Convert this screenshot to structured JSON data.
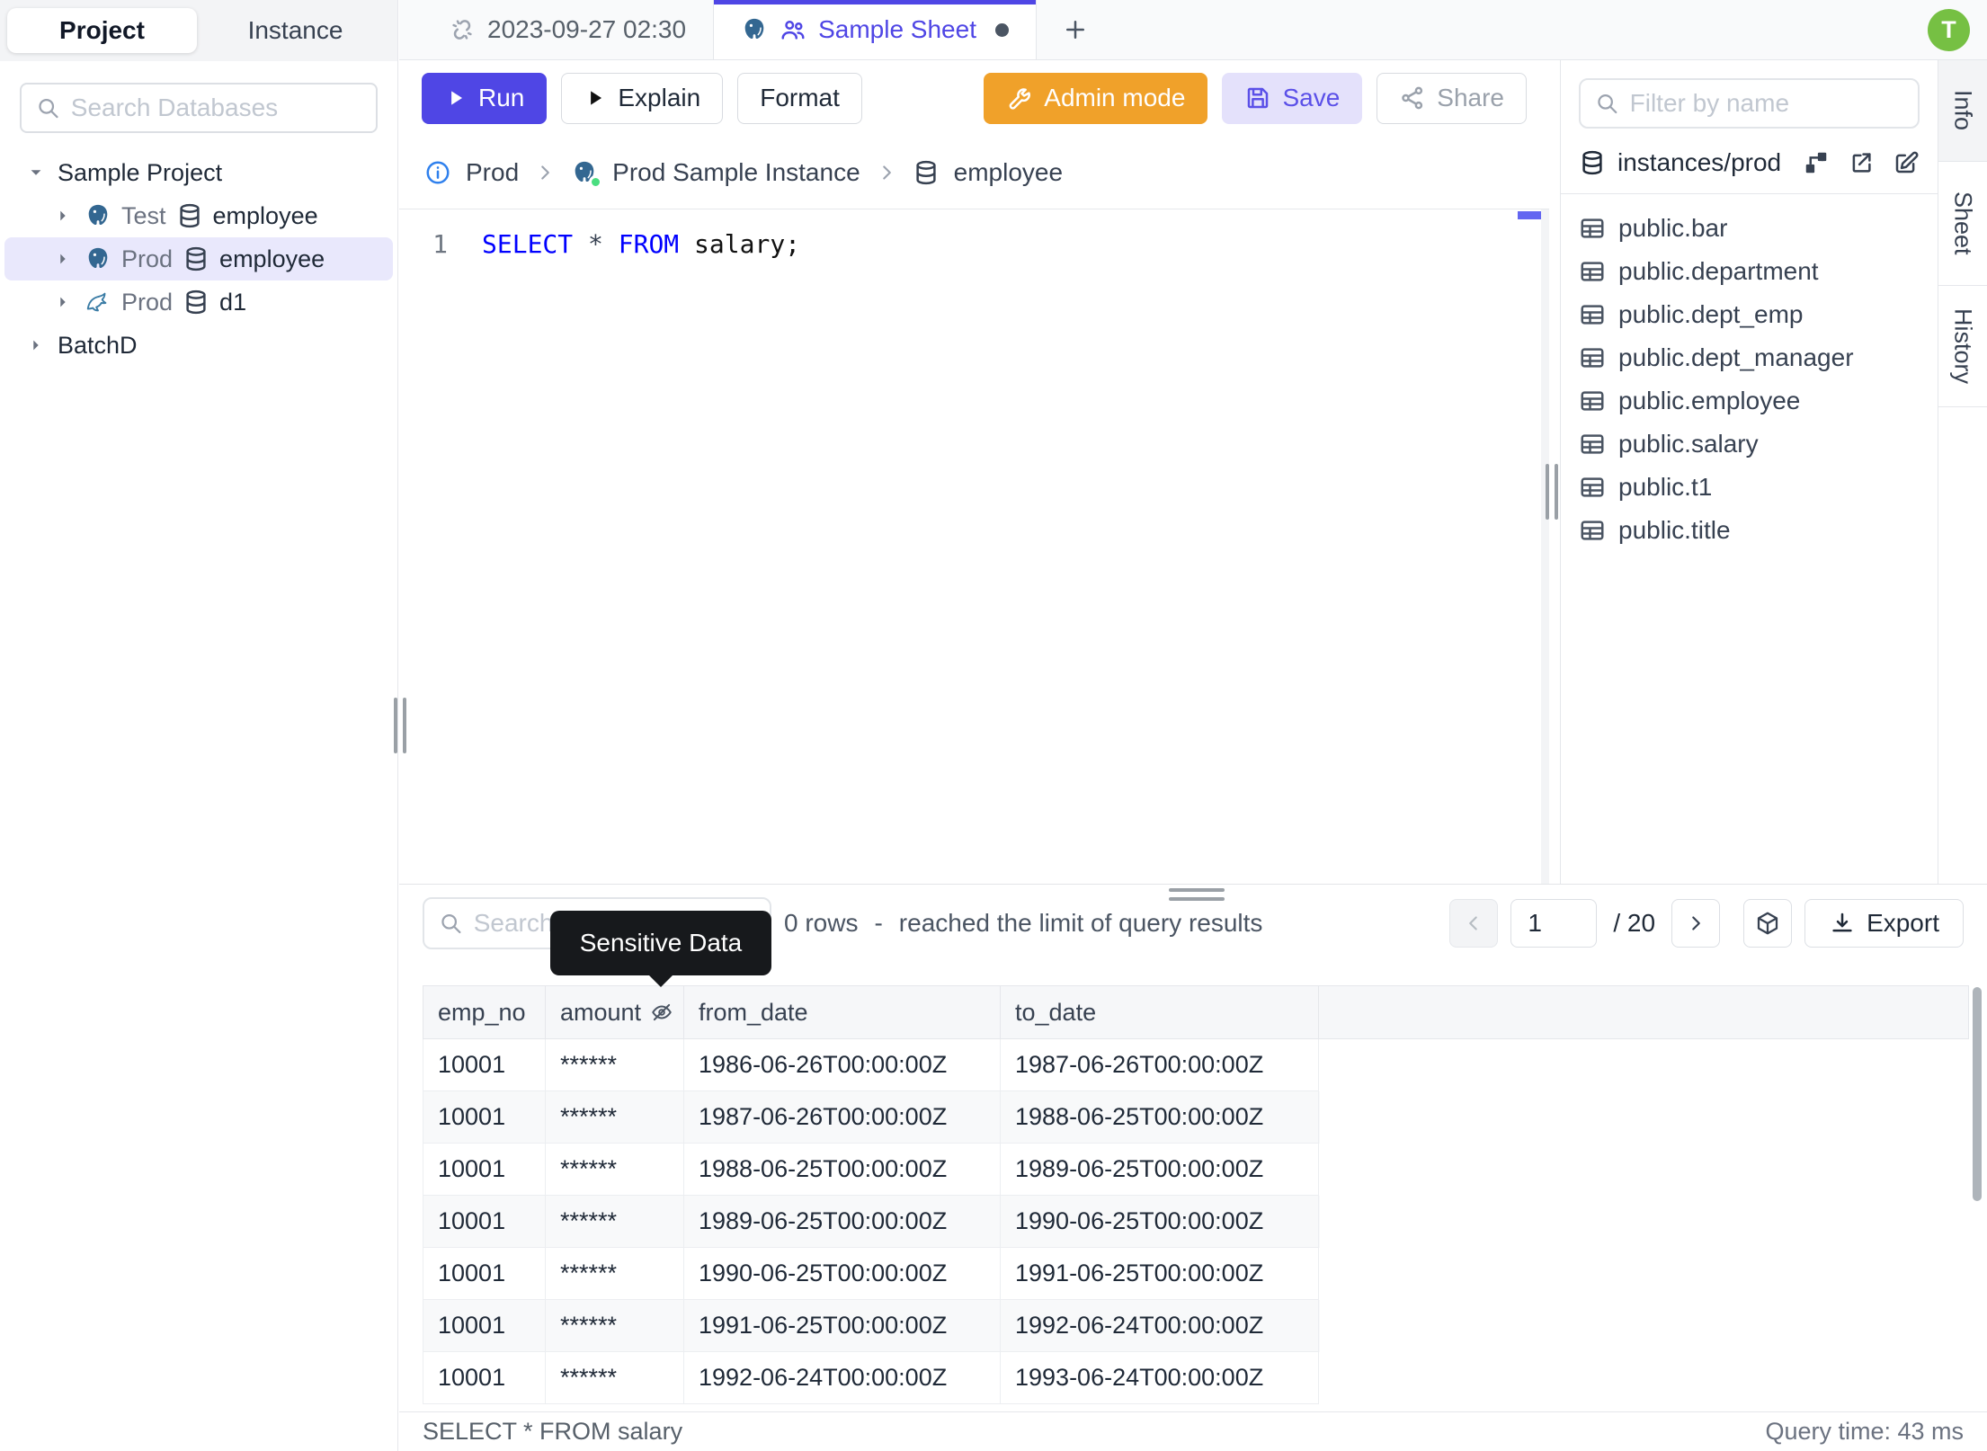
{
  "app": {
    "avatar_initial": "T"
  },
  "colors": {
    "accent": "#4f46e5",
    "admin_orange": "#f0a12a",
    "save_bg": "#e4e1fb",
    "avatar_green": "#76c043",
    "selected_tree_row": "#e9e8fc",
    "tooltip_bg": "#17191c",
    "status_dot_green": "#4ade80",
    "sql_keyword_blue": "#0000ff"
  },
  "left_sidebar": {
    "tabs": {
      "project": "Project",
      "instance": "Instance"
    },
    "search_placeholder": "Search Databases",
    "tree": {
      "project1": "Sample Project",
      "node1": {
        "env": "Test",
        "db": "employee"
      },
      "node2": {
        "env": "Prod",
        "db": "employee"
      },
      "node3": {
        "env": "Prod",
        "db": "d1"
      },
      "project2": "BatchD"
    }
  },
  "tab_bar": {
    "tab1": "2023-09-27 02:30",
    "tab2": "Sample Sheet"
  },
  "toolbar": {
    "run": "Run",
    "explain": "Explain",
    "format": "Format",
    "admin": "Admin mode",
    "save": "Save",
    "share": "Share"
  },
  "breadcrumb": {
    "env": "Prod",
    "instance": "Prod Sample Instance",
    "database": "employee"
  },
  "editor": {
    "line_number": "1",
    "kw_select": "SELECT",
    "star": "*",
    "kw_from": "FROM",
    "rest": "salary;"
  },
  "right_sidebar": {
    "filter_placeholder": "Filter by name",
    "source": "instances/prod",
    "tables": [
      "public.bar",
      "public.department",
      "public.dept_emp",
      "public.dept_manager",
      "public.employee",
      "public.salary",
      "public.t1",
      "public.title"
    ]
  },
  "right_tabs": {
    "info": "Info",
    "sheet": "Sheet",
    "history": "History"
  },
  "results": {
    "search_placeholder": "Search",
    "tooltip": "Sensitive Data",
    "rows_count": "0 rows",
    "dash": "-",
    "limit_note": "reached the limit of query results",
    "page": "1",
    "page_total": "/ 20",
    "export_label": "Export",
    "columns": {
      "c1": "emp_no",
      "c2": "amount",
      "c3": "from_date",
      "c4": "to_date"
    },
    "rows": [
      [
        "10001",
        "******",
        "1986-06-26T00:00:00Z",
        "1987-06-26T00:00:00Z"
      ],
      [
        "10001",
        "******",
        "1987-06-26T00:00:00Z",
        "1988-06-25T00:00:00Z"
      ],
      [
        "10001",
        "******",
        "1988-06-25T00:00:00Z",
        "1989-06-25T00:00:00Z"
      ],
      [
        "10001",
        "******",
        "1989-06-25T00:00:00Z",
        "1990-06-25T00:00:00Z"
      ],
      [
        "10001",
        "******",
        "1990-06-25T00:00:00Z",
        "1991-06-25T00:00:00Z"
      ],
      [
        "10001",
        "******",
        "1991-06-25T00:00:00Z",
        "1992-06-24T00:00:00Z"
      ],
      [
        "10001",
        "******",
        "1992-06-24T00:00:00Z",
        "1993-06-24T00:00:00Z"
      ]
    ]
  },
  "status_bar": {
    "query": "SELECT * FROM salary",
    "time": "Query time: 43 ms"
  }
}
